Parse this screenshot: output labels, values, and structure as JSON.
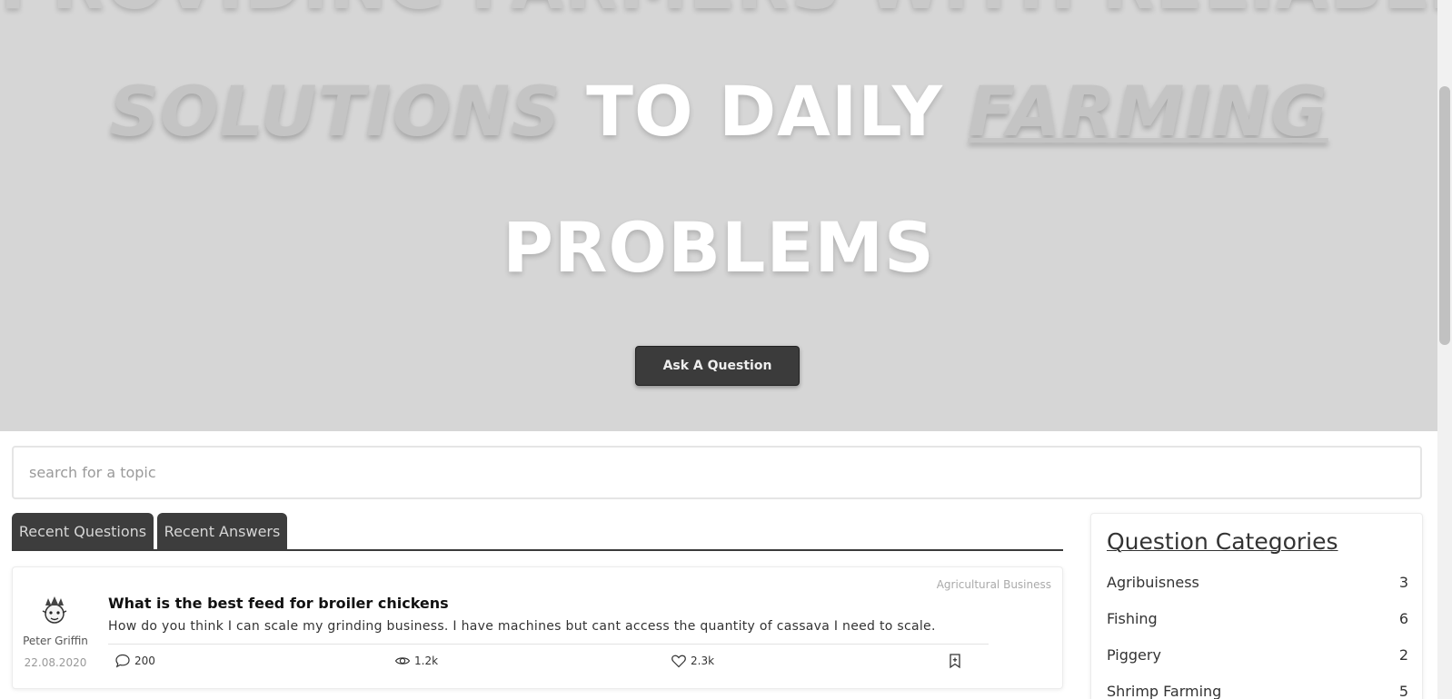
{
  "hero": {
    "line0": "PROVIDING FARMERS WITH RELIABLE",
    "line1_a": "SOLUTIONS",
    "line1_b": " TO DAILY ",
    "line1_c": "FARMING",
    "line2": "PROBLEMS",
    "ask_button": "Ask A Question"
  },
  "search": {
    "placeholder": "search for a topic"
  },
  "tabs": [
    {
      "label": "Recent Questions"
    },
    {
      "label": "Recent Answers"
    }
  ],
  "question": {
    "author": "Peter Griffin",
    "date": "22.08.2020",
    "category": "Agricultural Business",
    "title": "What is the best feed for broiler chickens",
    "body": "How do you think I can scale my grinding business. I have machines but cant access the quantity of cassava I need to scale.",
    "comments": "200",
    "views": "1.2k",
    "likes": "2.3k",
    "icons": [
      "chat-bubble-icon",
      "eye-icon",
      "heart-icon",
      "bookmark-icon"
    ]
  },
  "categories": {
    "title": "Question Categories",
    "items": [
      {
        "name": "Agribuisness",
        "count": "3"
      },
      {
        "name": "Fishing",
        "count": "6"
      },
      {
        "name": "Piggery",
        "count": "2"
      },
      {
        "name": "Shrimp Farming",
        "count": "5"
      }
    ]
  }
}
